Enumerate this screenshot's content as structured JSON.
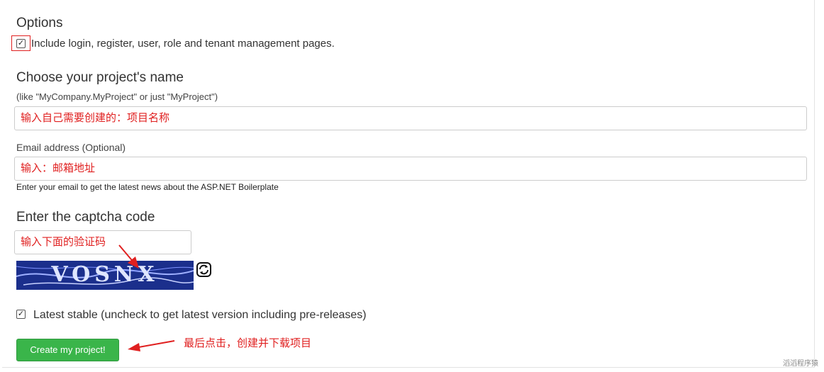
{
  "options": {
    "heading": "Options",
    "include_pages_label": "Include login, register, user, role and tenant management pages.",
    "include_pages_checked": true
  },
  "project_name": {
    "heading": "Choose your project's name",
    "hint": "(like \"MyCompany.MyProject\" or just \"MyProject\")",
    "value": "输入自己需要创建的：项目名称"
  },
  "email": {
    "label": "Email address (Optional)",
    "value": "输入：邮箱地址",
    "help": "Enter your email to get the latest news about the ASP.NET Boilerplate"
  },
  "captcha": {
    "heading": "Enter the captcha code",
    "value": "输入下面的验证码",
    "image_text": "VOSNX"
  },
  "latest_stable": {
    "label": "Latest stable (uncheck to get latest version including pre-releases)",
    "checked": true
  },
  "create_button": {
    "label": "Create my project!"
  },
  "annotations": {
    "final_step": "最后点击，创建并下载项目"
  },
  "watermark": "滔滔程序猿",
  "icons": {
    "checkbox_checked": "check-mark",
    "refresh": "refresh-icon"
  },
  "colors": {
    "button_green": "#3ab54a",
    "annotation_red": "#e02020",
    "captcha_blue": "#1b2f8c"
  }
}
